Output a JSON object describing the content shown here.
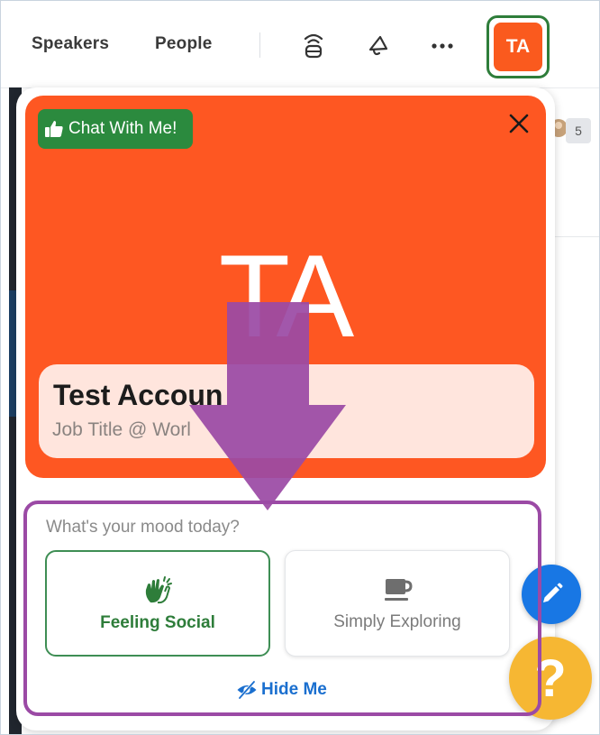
{
  "topbar": {
    "nav_speakers": "Speakers",
    "nav_people": "People",
    "icons": [
      "cast-icon",
      "megaphone-icon",
      "more-icon"
    ],
    "avatar_initials": "TA"
  },
  "background": {
    "count_badge": "5"
  },
  "profile": {
    "chat_badge_label": "Chat With Me!",
    "initials": "TA",
    "name": "Test Accoun",
    "job": "Job Title @ Worl"
  },
  "mood": {
    "question": "What's your mood today?",
    "options": [
      {
        "label": "Feeling Social",
        "icon": "clapping-hands-icon",
        "selected": true
      },
      {
        "label": "Simply Exploring",
        "icon": "coffee-cup-icon",
        "selected": false
      }
    ],
    "hide_label": "Hide Me"
  },
  "help_button": "?",
  "colors": {
    "brand_orange": "#fe5722",
    "name_card_bg": "#ffe5dd",
    "success_green": "#2b8a3e",
    "link_blue": "#1a6fcf",
    "fab_blue": "#1877e4",
    "help_yellow": "#f6b733",
    "annotation_purple": "#9b4aa5"
  }
}
